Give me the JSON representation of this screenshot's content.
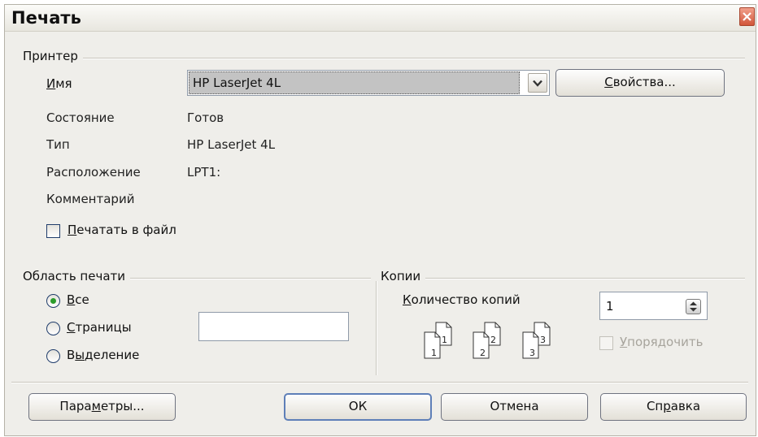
{
  "window": {
    "title": "Печать"
  },
  "printer": {
    "group_title": "Принтер",
    "name_label_u": "И",
    "name_label_rest": "мя",
    "name_value": "HP LaserJet 4L",
    "properties_u": "С",
    "properties_rest": "войства...",
    "status_label": "Состояние",
    "status_value": "Готов",
    "type_label": "Тип",
    "type_value": "HP LaserJet 4L",
    "location_label": "Расположение",
    "location_value": "LPT1:",
    "comment_label": "Комментарий",
    "print_to_file_u": "П",
    "print_to_file_rest": "ечатать в файл",
    "print_to_file_checked": false
  },
  "print_range": {
    "group_title": "Область печати",
    "all_u": "В",
    "all_rest": "се",
    "pages_u": "С",
    "pages_rest": "траницы",
    "pages_value": "",
    "selection_pre": "В",
    "selection_u": "ы",
    "selection_rest": "деление",
    "selected": "all"
  },
  "copies": {
    "group_title": "Копии",
    "count_u": "К",
    "count_rest": "оличество копий",
    "count_value": "1",
    "collate_u": "У",
    "collate_rest": "порядочить",
    "collate_checked": false,
    "collate_enabled": false,
    "icon_labels": [
      "1",
      "1",
      "2",
      "2",
      "3",
      "3"
    ]
  },
  "footer": {
    "options_pre": "Пара",
    "options_u": "м",
    "options_rest": "етры...",
    "ok_label": "ОК",
    "cancel_label": "Отмена",
    "help_pre": "Сп",
    "help_u": "р",
    "help_rest": "авка"
  },
  "colors": {
    "dialog_bg": "#efeeea",
    "radio_selected": "#2b9c2b",
    "close_button": "#d2563a",
    "default_button_border": "#5e7fb8"
  }
}
